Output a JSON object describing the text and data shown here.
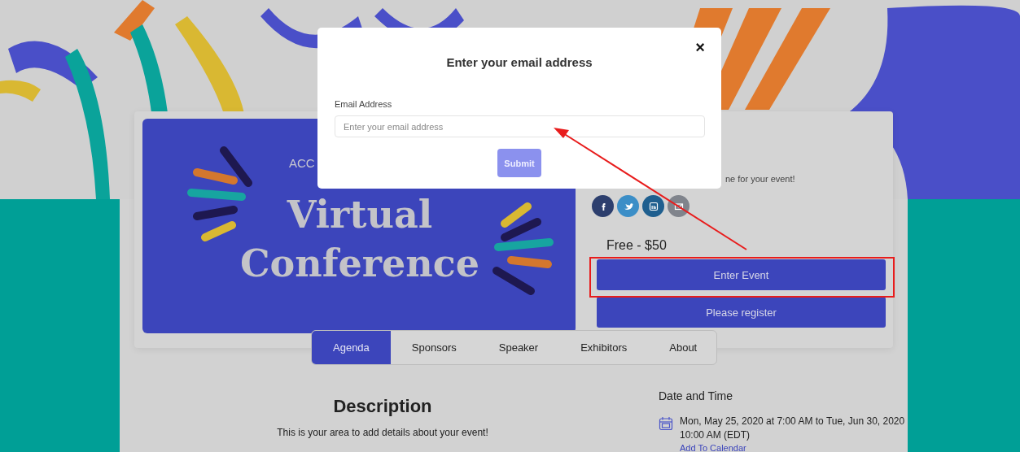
{
  "modal": {
    "title": "Enter your email address",
    "close": "×",
    "field_label": "Email Address",
    "placeholder": "Enter your email address",
    "submit": "Submit"
  },
  "banner": {
    "kicker": "ACC",
    "title_lines": [
      "Virtual",
      "Conference"
    ]
  },
  "event": {
    "tagline": "ne for your event!",
    "social": [
      {
        "kind": "facebook",
        "color": "#2d3f6e"
      },
      {
        "kind": "twitter",
        "color": "#3b8ec7"
      },
      {
        "kind": "linkedin",
        "color": "#1f5f8f"
      },
      {
        "kind": "email",
        "color": "#80848c"
      }
    ],
    "price": "Free - $50",
    "buttons": [
      "Enter Event",
      "Please register"
    ]
  },
  "tabs": [
    {
      "label": "Agenda",
      "selected": true
    },
    {
      "label": "Sponsors",
      "selected": false
    },
    {
      "label": "Speaker",
      "selected": false
    },
    {
      "label": "Exhibitors",
      "selected": false
    },
    {
      "label": "About",
      "selected": false
    }
  ],
  "description": {
    "heading": "Description",
    "text": "This is your area to add details about your event!"
  },
  "date_time": {
    "heading": "Date and Time",
    "text": "Mon, May 25, 2020 at 7:00 AM to Tue, Jun 30, 2020 10:00 AM (EDT)",
    "link": "Add To Calendar"
  }
}
